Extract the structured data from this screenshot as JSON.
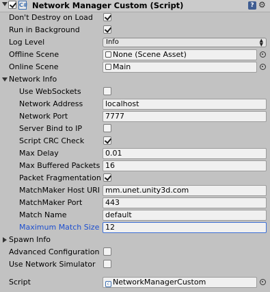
{
  "component": {
    "title": "Network Manager Custom (Script)",
    "script_icon": "C#"
  },
  "fields": {
    "dont_destroy": {
      "label": "Don't Destroy on Load",
      "checked": true
    },
    "run_background": {
      "label": "Run in Background",
      "checked": true
    },
    "log_level": {
      "label": "Log Level",
      "value": "Info"
    },
    "offline_scene": {
      "label": "Offline Scene",
      "value": "None (Scene Asset)"
    },
    "online_scene": {
      "label": "Online Scene",
      "value": "Main"
    }
  },
  "network_info": {
    "label": "Network Info",
    "use_websockets": {
      "label": "Use WebSockets",
      "checked": false
    },
    "network_address": {
      "label": "Network Address",
      "value": "localhost"
    },
    "network_port": {
      "label": "Network Port",
      "value": "7777"
    },
    "server_bind": {
      "label": "Server Bind to IP",
      "checked": false
    },
    "script_crc": {
      "label": "Script CRC Check",
      "checked": true
    },
    "max_delay": {
      "label": "Max Delay",
      "value": "0.01"
    },
    "max_buffered": {
      "label": "Max Buffered Packets",
      "value": "16"
    },
    "packet_frag": {
      "label": "Packet Fragmentation",
      "checked": true
    },
    "mm_host": {
      "label": "MatchMaker Host URI",
      "value": "mm.unet.unity3d.com"
    },
    "mm_port": {
      "label": "MatchMaker Port",
      "value": "443"
    },
    "match_name": {
      "label": "Match Name",
      "value": "default"
    },
    "max_match_size": {
      "label": "Maximum Match Size",
      "value": "12"
    }
  },
  "spawn_info": {
    "label": "Spawn Info"
  },
  "advanced_config": {
    "label": "Advanced Configuration",
    "checked": false
  },
  "use_simulator": {
    "label": "Use Network Simulator",
    "checked": false
  },
  "script": {
    "label": "Script",
    "value": "NetworkManagerCustom"
  },
  "colors": {
    "selection": "#1d4fd0",
    "background": "#c2c2c2"
  }
}
